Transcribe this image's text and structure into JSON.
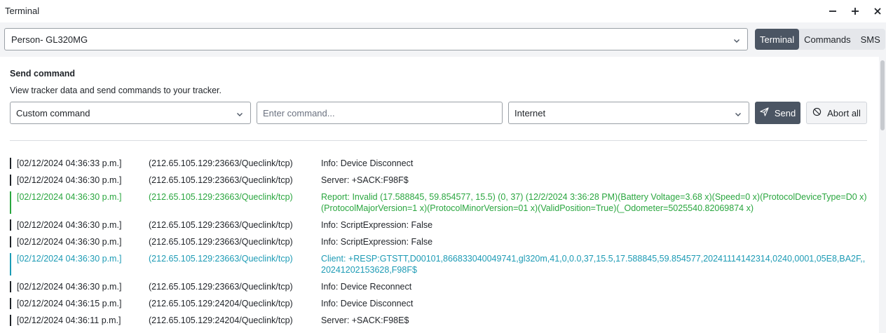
{
  "window": {
    "title": "Terminal",
    "controls": [
      "minimize",
      "maximize",
      "close"
    ]
  },
  "device_select": {
    "value": "Person- GL320MG"
  },
  "tabs": [
    {
      "label": "Terminal",
      "active": true
    },
    {
      "label": "Commands",
      "active": false
    },
    {
      "label": "SMS",
      "active": false
    }
  ],
  "send_command": {
    "title": "Send command",
    "description": "View tracker data and send commands to your tracker.",
    "command_type": "Custom command",
    "command_placeholder": "Enter command...",
    "channel": "Internet",
    "send_label": "Send",
    "abort_label": "Abort all"
  },
  "colors": {
    "accent": "#4b5563",
    "report": "#2aa63f",
    "client": "#1d9bb5",
    "default": "#1f2328"
  },
  "log": [
    {
      "time": "[02/12/2024 04:36:33 p.m.]",
      "source": "(212.65.105.129:23663/Queclink/tcp)",
      "message": "Info: Device Disconnect",
      "kind": "default"
    },
    {
      "time": "[02/12/2024 04:36:30 p.m.]",
      "source": "(212.65.105.129:23663/Queclink/tcp)",
      "message": "Server: +SACK:F98F$",
      "kind": "default"
    },
    {
      "time": "[02/12/2024 04:36:30 p.m.]",
      "source": "(212.65.105.129:23663/Queclink/tcp)",
      "message": "Report: Invalid (17.588845, 59.854577, 15.5) (0, 37) (12/2/2024 3:36:28 PM)(Battery Voltage=3.68 x)(Speed=0 x)(ProtocolDeviceType=D0 x)(ProtocolMajorVersion=1 x)(ProtocolMinorVersion=01 x)(ValidPosition=True)(_Odometer=5025540.82069874 x)",
      "kind": "green"
    },
    {
      "time": "[02/12/2024 04:36:30 p.m.]",
      "source": "(212.65.105.129:23663/Queclink/tcp)",
      "message": "Info: ScriptExpression: False",
      "kind": "default"
    },
    {
      "time": "[02/12/2024 04:36:30 p.m.]",
      "source": "(212.65.105.129:23663/Queclink/tcp)",
      "message": "Info: ScriptExpression: False",
      "kind": "default"
    },
    {
      "time": "[02/12/2024 04:36:30 p.m.]",
      "source": "(212.65.105.129:23663/Queclink/tcp)",
      "message": "Client: +RESP:GTSTT,D00101,866833040049741,gl320m,41,0,0.0,37,15.5,17.588845,59.854577,20241114142314,0240,0001,05E8,BA2F,,20241202153628,F98F$",
      "kind": "teal"
    },
    {
      "time": "[02/12/2024 04:36:30 p.m.]",
      "source": "(212.65.105.129:23663/Queclink/tcp)",
      "message": "Info: Device Reconnect",
      "kind": "default"
    },
    {
      "time": "[02/12/2024 04:36:15 p.m.]",
      "source": "(212.65.105.129:24204/Queclink/tcp)",
      "message": "Info: Device Disconnect",
      "kind": "default"
    },
    {
      "time": "[02/12/2024 04:36:11 p.m.]",
      "source": "(212.65.105.129:24204/Queclink/tcp)",
      "message": "Server: +SACK:F98E$",
      "kind": "default"
    }
  ]
}
